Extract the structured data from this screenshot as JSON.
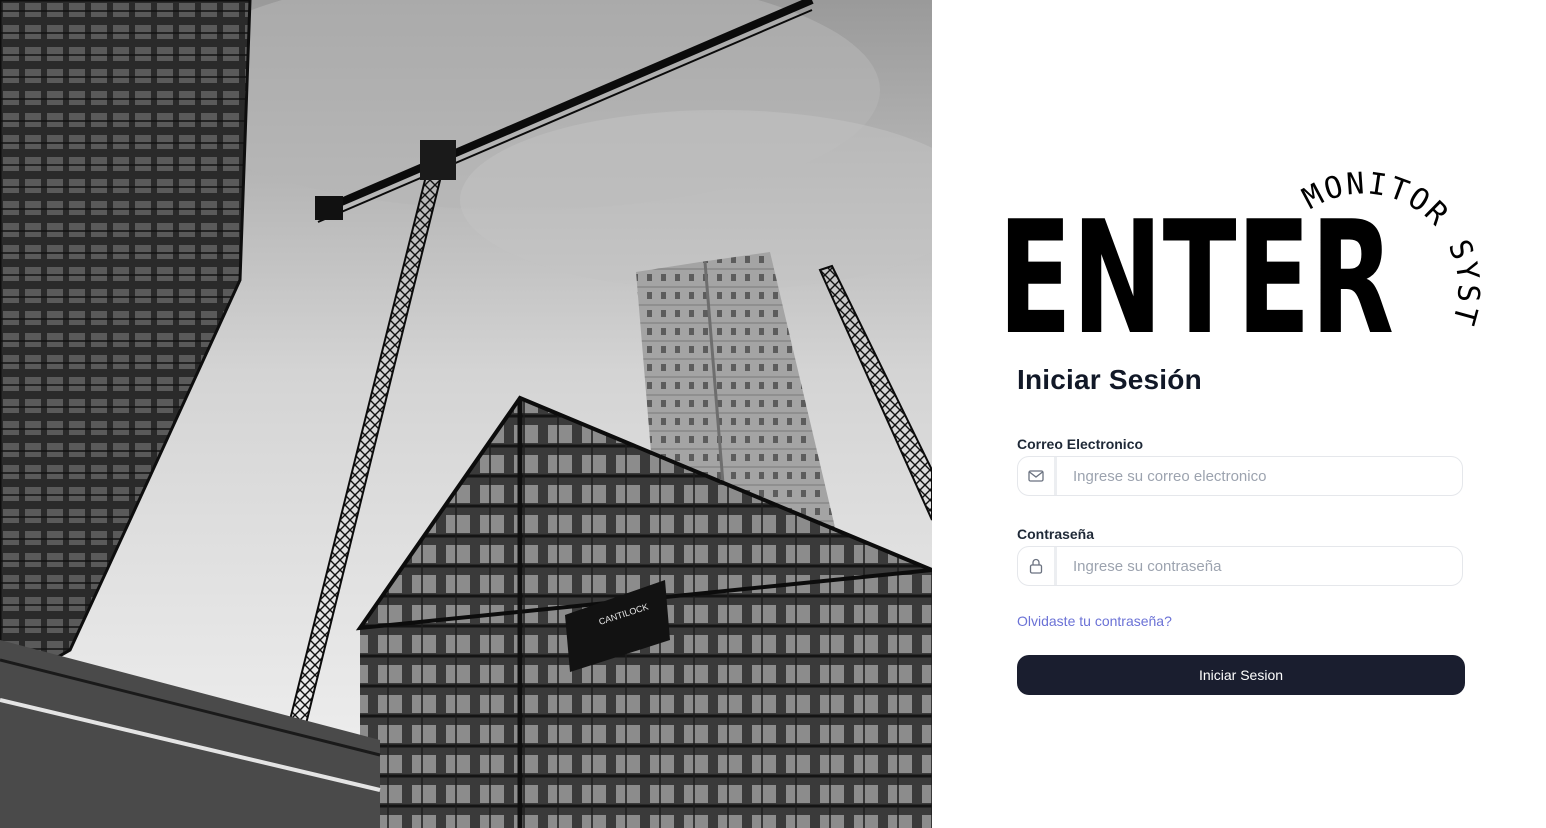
{
  "hero": {
    "image": "construction-site-cranes-photo",
    "sign_text": "CANTILOCK"
  },
  "logo": {
    "word": "ENTER",
    "ring_text": "MONITOR SYSTEM"
  },
  "login": {
    "title": "Iniciar Sesión",
    "email_label": "Correo Electronico",
    "email_placeholder": "Ingrese su correo electronico",
    "email_value": "",
    "email_icon": "mail-icon",
    "password_label": "Contraseña",
    "password_placeholder": "Ingrese su contraseña",
    "password_value": "",
    "password_icon": "lock-icon",
    "forgot_link": "Olvidaste tu contraseña?",
    "submit_label": "Iniciar Sesion"
  },
  "colors": {
    "primary_button": "#1a1e2f",
    "link": "#6b72d6",
    "text": "#111827"
  }
}
